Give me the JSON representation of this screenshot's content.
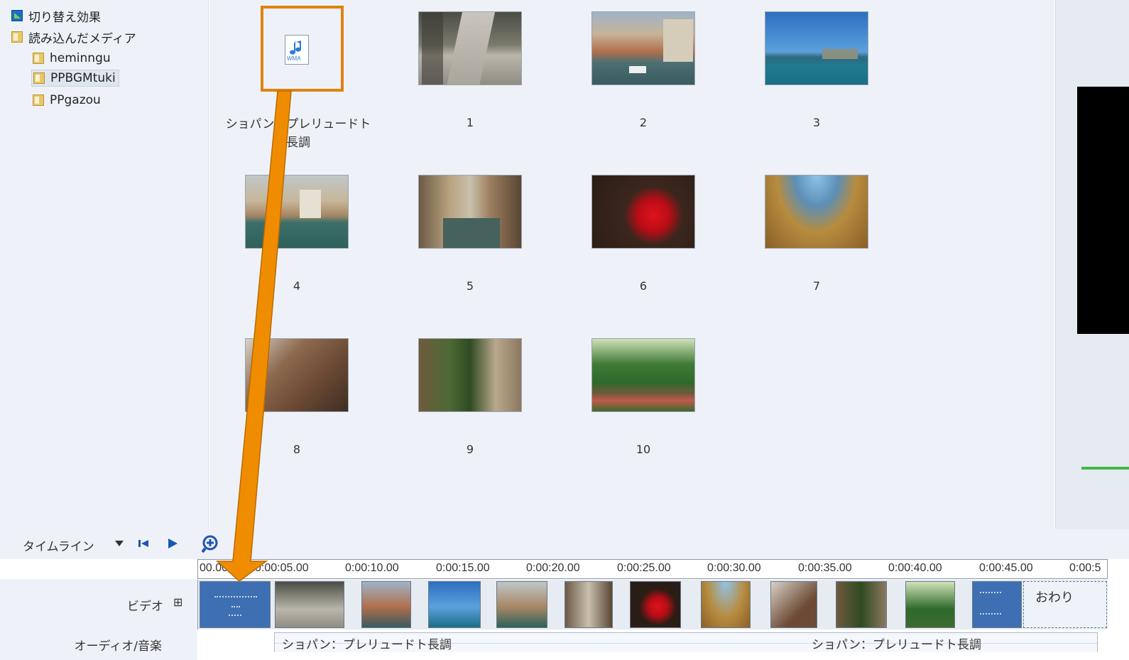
{
  "tree": {
    "items": [
      {
        "label": "切り替え効果",
        "icon": "transition-icon"
      },
      {
        "label": "読み込んだメディア",
        "icon": "folder-icon"
      },
      {
        "label": "heminngu",
        "icon": "folder-icon"
      },
      {
        "label": "PPBGMtuki",
        "icon": "folder-icon",
        "selected": true
      },
      {
        "label": "PPgazou",
        "icon": "folder-icon"
      }
    ]
  },
  "media": {
    "audio_file": {
      "badge": "WMA",
      "caption_line1": "ショパン：プレリュードト",
      "caption_line2": "長調"
    },
    "images": [
      "1",
      "2",
      "3",
      "4",
      "5",
      "6",
      "7",
      "8",
      "9",
      "10"
    ]
  },
  "timeline": {
    "label": "タイムライン",
    "ruler_ticks": [
      "00.00",
      "0:00:05.00",
      "0:00:10.00",
      "0:00:15.00",
      "0:00:20.00",
      "0:00:25.00",
      "0:00:30.00",
      "0:00:35.00",
      "0:00:40.00",
      "0:00:45.00",
      "0:00:5"
    ],
    "video_label": "ビデオ",
    "expand_glyph": "⊞",
    "audio_label": "オーディオ/音楽",
    "end_clip_text": "おわり",
    "audio_clip_text_1": "ショパン：プレリュードト長調",
    "audio_clip_text_2": "ショパン：プレリュードト長調"
  },
  "colors": {
    "accent_orange": "#e0820f",
    "toolbar_blue": "#1d55b5",
    "preview_green": "#45b649"
  }
}
